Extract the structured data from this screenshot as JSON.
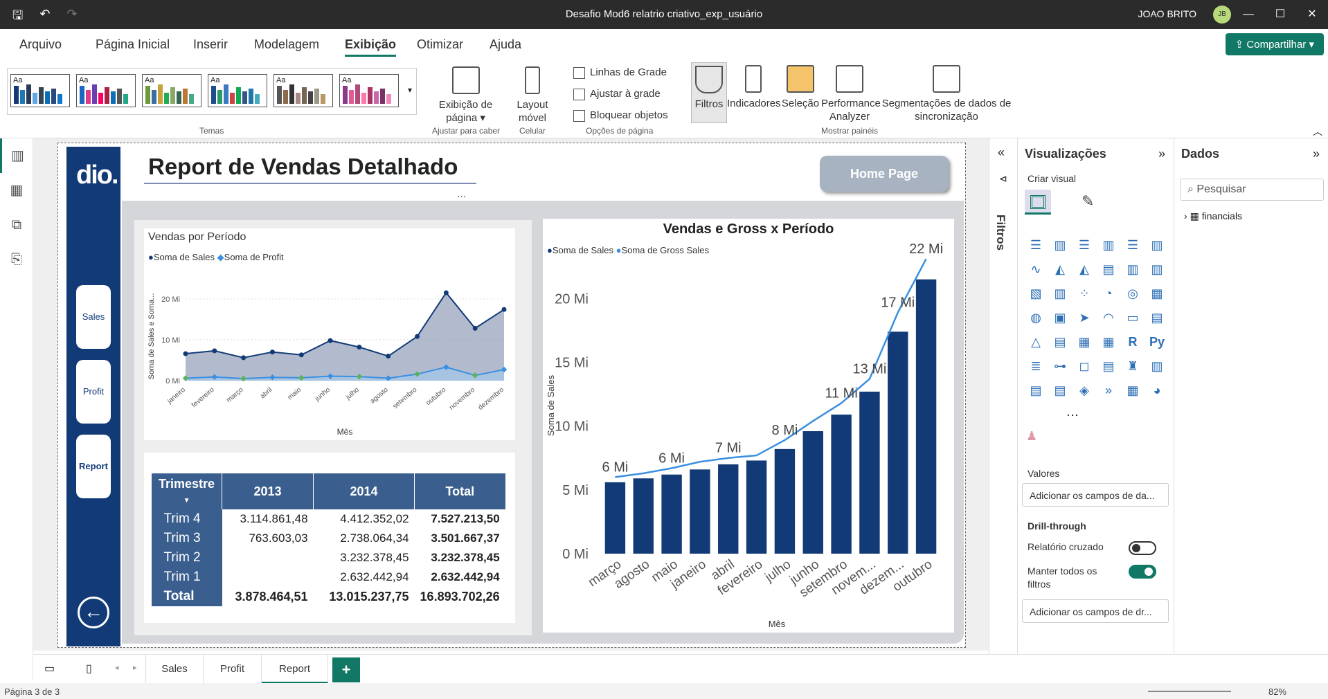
{
  "window": {
    "title": "Desafio Mod6 relatrio criativo_exp_usuário",
    "user": "JOAO BRITO",
    "avatar": "JB"
  },
  "menu": {
    "items": [
      "Arquivo",
      "Página Inicial",
      "Inserir",
      "Modelagem",
      "Exibição",
      "Otimizar",
      "Ajuda"
    ],
    "active": "Exibição",
    "share": "Compartilhar"
  },
  "ribbon": {
    "themes_label": "Temas",
    "page_view": "Exibição de página",
    "fit_label": "Ajustar para caber",
    "mobile_layout": "Layout móvel",
    "mobile_label": "Celular",
    "checkboxes": [
      "Linhas de Grade",
      "Ajustar à grade",
      "Bloquear objetos"
    ],
    "page_options_label": "Opções de página",
    "panes": [
      "Filtros",
      "Indicadores",
      "Seleção",
      "Performance Analyzer",
      "Segmentações de dados de sincronização"
    ],
    "panes_label": "Mostrar painéis"
  },
  "report": {
    "logo": "dio.",
    "title": "Report de Vendas Detalhado",
    "home_button": "Home Page",
    "nav": [
      "Sales",
      "Profit",
      "Report"
    ],
    "more": "..."
  },
  "line_chart": {
    "title": "Vendas por Período",
    "legend": [
      "Soma de  Sales",
      "Soma de Profit"
    ],
    "ylabel": "Soma de Sales e Soma...",
    "xlabel": "Mês",
    "yticks": [
      "20 Mi",
      "10 Mi",
      "0 Mi"
    ]
  },
  "combo_chart": {
    "title": "Vendas e Gross x Período",
    "legend": [
      "Soma de  Sales",
      "Soma de Gross Sales"
    ],
    "ylabel": "Soma de Sales",
    "xlabel": "Mês",
    "yticks": [
      "20 Mi",
      "15 Mi",
      "10 Mi",
      "5 Mi",
      "0 Mi"
    ],
    "data_labels": [
      "6 Mi",
      "6 Mi",
      "7 Mi",
      "8 Mi",
      "11 Mi",
      "13 Mi",
      "17 Mi",
      "22 Mi"
    ]
  },
  "chart_data": [
    {
      "type": "area",
      "title": "Vendas por Período",
      "xlabel": "Mês",
      "ylabel": "Soma de Sales e Soma...",
      "categories": [
        "janeiro",
        "fevereiro",
        "março",
        "abril",
        "maio",
        "junho",
        "julho",
        "agosto",
        "setembro",
        "outubro",
        "novembro",
        "dezembro"
      ],
      "series": [
        {
          "name": "Soma de  Sales",
          "values": [
            6.6,
            7.3,
            5.6,
            7.0,
            6.3,
            9.8,
            8.2,
            6.0,
            10.8,
            21.5,
            12.8,
            17.4
          ]
        },
        {
          "name": "Soma de Profit",
          "values": [
            0.6,
            0.9,
            0.5,
            0.8,
            0.7,
            1.1,
            1.0,
            0.6,
            1.6,
            3.3,
            1.3,
            2.7
          ]
        }
      ],
      "ylim": [
        0,
        22
      ],
      "legend": "top-left"
    },
    {
      "type": "bar",
      "title": "Vendas e Gross x Período",
      "xlabel": "Mês",
      "ylabel": "Soma de Sales",
      "categories": [
        "março",
        "agosto",
        "maio",
        "janeiro",
        "abril",
        "fevereiro",
        "julho",
        "junho",
        "setembro",
        "novem...",
        "dezem...",
        "outubro"
      ],
      "series": [
        {
          "name": "Soma de  Sales",
          "values": [
            5.6,
            5.9,
            6.2,
            6.6,
            7.0,
            7.3,
            8.2,
            9.6,
            10.9,
            12.7,
            17.4,
            21.5
          ]
        },
        {
          "name": "Soma de Gross Sales",
          "values": [
            6.0,
            6.3,
            6.7,
            7.2,
            7.5,
            7.7,
            8.9,
            10.4,
            11.8,
            13.7,
            18.9,
            23.1
          ]
        }
      ],
      "ylim": [
        0,
        23
      ],
      "legend": "top-left"
    }
  ],
  "matrix": {
    "headers": [
      "Trimestre",
      "2013",
      "2014",
      "Total"
    ],
    "rows": [
      {
        "label": "Trim 4",
        "y2013": "3.114.861,48",
        "y2014": "4.412.352,02",
        "total": "7.527.213,50"
      },
      {
        "label": "Trim 3",
        "y2013": "763.603,03",
        "y2014": "2.738.064,34",
        "total": "3.501.667,37"
      },
      {
        "label": "Trim 2",
        "y2013": "",
        "y2014": "3.232.378,45",
        "total": "3.232.378,45"
      },
      {
        "label": "Trim 1",
        "y2013": "",
        "y2014": "2.632.442,94",
        "total": "2.632.442,94"
      }
    ],
    "total": {
      "label": "Total",
      "y2013": "3.878.464,51",
      "y2014": "13.015.237,75",
      "total": "16.893.702,26"
    }
  },
  "filters_pane": {
    "label": "Filtros"
  },
  "visualizations": {
    "title": "Visualizações",
    "build": "Criar visual",
    "values_label": "Valores",
    "values_placeholder": "Adicionar os campos de da...",
    "drill_label": "Drill-through",
    "cross_report": "Relatório cruzado",
    "keep_filters": "Manter todos os filtros",
    "drill_placeholder": "Adicionar os campos de dr..."
  },
  "data_pane": {
    "title": "Dados",
    "search_placeholder": "Pesquisar",
    "table": "financials"
  },
  "pages": {
    "tabs": [
      "Sales",
      "Profit",
      "Report"
    ],
    "active": "Report",
    "add": "+"
  },
  "status": {
    "page": "Página 3 de 3",
    "zoom": "82%"
  },
  "colors": {
    "navy": "#123a77",
    "sales": "#123a77",
    "profit": "#3b8fe0",
    "accent": "#117865",
    "matrix_header": "#3a5f8e"
  }
}
